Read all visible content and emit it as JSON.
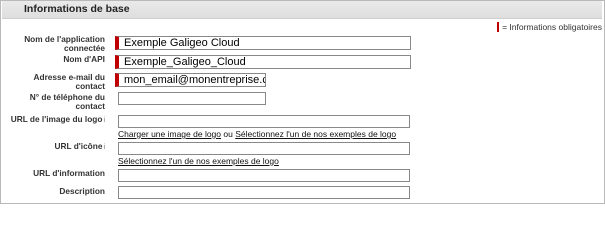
{
  "section": {
    "title": "Informations de base"
  },
  "legend": {
    "text": "= Informations obligatoires"
  },
  "fields": [
    {
      "label_line1": "Nom de l'application",
      "label_line2": "connectée",
      "value": "Exemple Galigeo Cloud"
    },
    {
      "label": "Nom d'API",
      "value": "Exemple_Galigeo_Cloud"
    },
    {
      "label": "Adresse e-mail du contact",
      "value": "mon_email@monentreprise.com"
    },
    {
      "label": "N° de téléphone du contact",
      "value": ""
    },
    {
      "label": "URL de l'image du logo",
      "info_icon": "i",
      "value": ""
    },
    {
      "label": "URL d'icône",
      "info_icon": "i",
      "value": ""
    },
    {
      "label": "URL d'information",
      "value": ""
    },
    {
      "label": "Description",
      "value": ""
    }
  ],
  "logo_links": {
    "upload": "Charger une image de logo",
    "separator": "ou",
    "samples": "Sélectionnez l'un de nos exemples de logo"
  },
  "icon_links": {
    "samples": "Sélectionnez l'un de nos exemples de logo"
  },
  "colors": {
    "required": "#c00000",
    "header_bg": "#e3e3e3"
  }
}
